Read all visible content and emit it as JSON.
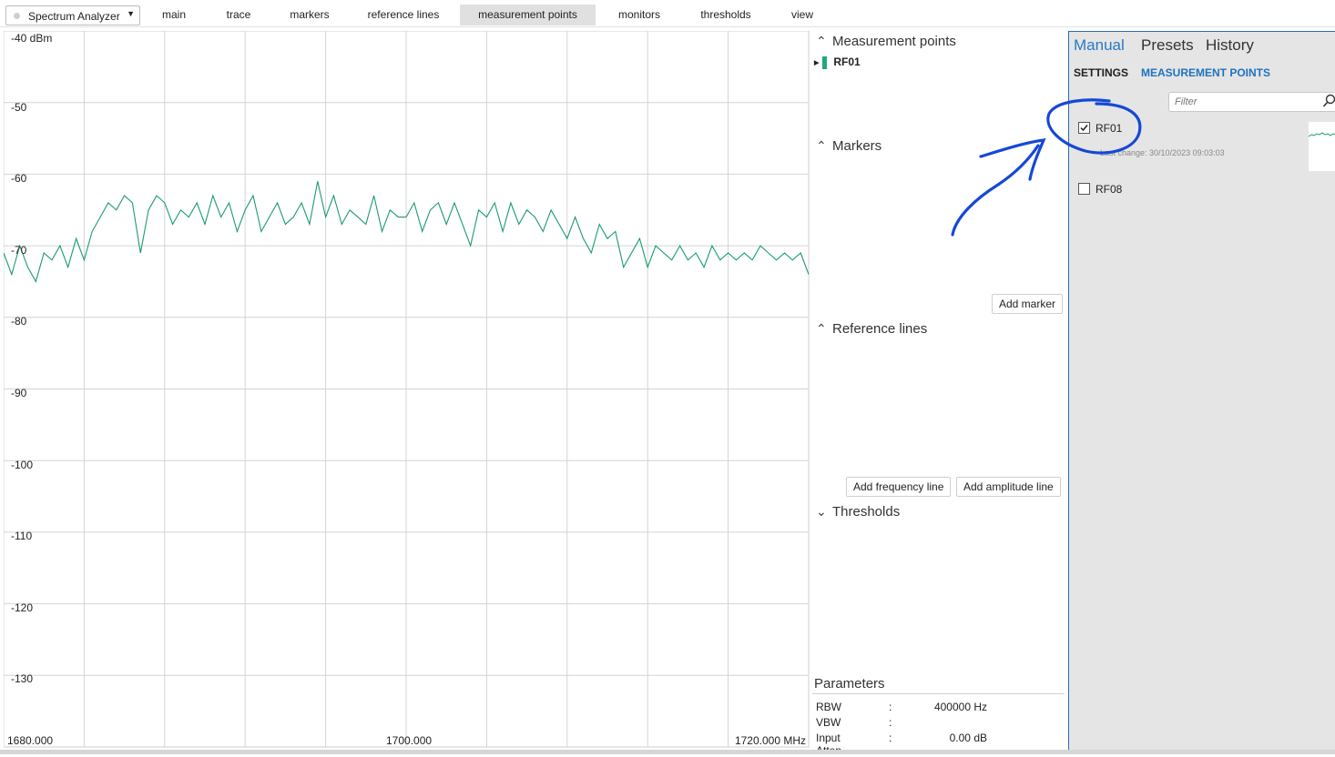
{
  "toolbar": {
    "app_selector": "Spectrum Analyzer",
    "tabs": [
      {
        "label": "main",
        "active": false
      },
      {
        "label": "trace",
        "active": false
      },
      {
        "label": "markers",
        "active": false
      },
      {
        "label": "reference lines",
        "active": false
      },
      {
        "label": "measurement points",
        "active": true
      },
      {
        "label": "monitors",
        "active": false
      },
      {
        "label": "thresholds",
        "active": false
      },
      {
        "label": "view",
        "active": false
      }
    ]
  },
  "chart_data": {
    "type": "line",
    "y_ticks": [
      "-40 dBm",
      "-50",
      "-60",
      "-70",
      "-80",
      "-90",
      "-100",
      "-110",
      "-120",
      "-130"
    ],
    "ylim": [
      -140,
      -40
    ],
    "x_tick_labels": [
      "1680.000",
      "1700.000",
      "1720.000 MHz"
    ],
    "xlim": [
      1680,
      1720
    ],
    "grid": true,
    "series": [
      {
        "color": "#1a9a74",
        "x": [
          1680.0,
          1680.4,
          1680.8,
          1681.2,
          1681.6,
          1682.0,
          1682.4,
          1682.8,
          1683.2,
          1683.6,
          1684.0,
          1684.4,
          1684.8,
          1685.2,
          1685.6,
          1686.0,
          1686.4,
          1686.8,
          1687.2,
          1687.6,
          1688.0,
          1688.4,
          1688.8,
          1689.2,
          1689.6,
          1690.0,
          1690.4,
          1690.8,
          1691.2,
          1691.6,
          1692.0,
          1692.4,
          1692.8,
          1693.2,
          1693.6,
          1694.0,
          1694.4,
          1694.8,
          1695.2,
          1695.6,
          1696.0,
          1696.4,
          1696.8,
          1697.2,
          1697.6,
          1698.0,
          1698.4,
          1698.8,
          1699.2,
          1699.6,
          1700.0,
          1700.4,
          1700.8,
          1701.2,
          1701.6,
          1702.0,
          1702.4,
          1702.8,
          1703.2,
          1703.6,
          1704.0,
          1704.4,
          1704.8,
          1705.2,
          1705.6,
          1706.0,
          1706.4,
          1706.8,
          1707.2,
          1707.6,
          1708.0,
          1708.4,
          1708.8,
          1709.2,
          1709.6,
          1710.0,
          1710.4,
          1710.8,
          1711.2,
          1711.6,
          1712.0,
          1712.4,
          1712.8,
          1713.2,
          1713.6,
          1714.0,
          1714.4,
          1714.8,
          1715.2,
          1715.6,
          1716.0,
          1716.4,
          1716.8,
          1717.2,
          1717.6,
          1718.0,
          1718.4,
          1718.8,
          1719.2,
          1719.6,
          1720.0
        ],
        "y": [
          -71,
          -74,
          -70,
          -73,
          -75,
          -71,
          -72,
          -70,
          -73,
          -69,
          -72,
          -68,
          -66,
          -64,
          -65,
          -63,
          -64,
          -71,
          -65,
          -63,
          -64,
          -67,
          -65,
          -66,
          -64,
          -67,
          -63,
          -66,
          -64,
          -68,
          -65,
          -63,
          -68,
          -66,
          -64,
          -67,
          -66,
          -64,
          -67,
          -61,
          -66,
          -63,
          -67,
          -65,
          -66,
          -67,
          -63,
          -68,
          -65,
          -66,
          -66,
          -64,
          -68,
          -65,
          -64,
          -67,
          -64,
          -67,
          -70,
          -65,
          -66,
          -64,
          -68,
          -64,
          -67,
          -65,
          -66,
          -68,
          -65,
          -67,
          -69,
          -66,
          -69,
          -71,
          -67,
          -69,
          -68,
          -73,
          -71,
          -69,
          -73,
          -70,
          -71,
          -72,
          -70,
          -72,
          -71,
          -73,
          -70,
          -72,
          -71,
          -72,
          -71,
          -72,
          -70,
          -71,
          -72,
          -71,
          -72,
          -71,
          -74
        ]
      }
    ]
  },
  "side": {
    "measurement_points": {
      "title": "Measurement points",
      "items": [
        "RF01"
      ]
    },
    "markers": {
      "title": "Markers",
      "add_label": "Add marker"
    },
    "reference_lines": {
      "title": "Reference lines",
      "add_freq_label": "Add frequency line",
      "add_amp_label": "Add amplitude line"
    },
    "thresholds": {
      "title": "Thresholds"
    },
    "parameters": {
      "title": "Parameters",
      "rows": [
        {
          "key": "RBW",
          "sep": ":",
          "value": "400000 Hz"
        },
        {
          "key": "VBW",
          "sep": ":",
          "value": ""
        },
        {
          "key": "Input Atten.",
          "sep": ":",
          "value": "0.00 dB"
        }
      ]
    }
  },
  "right": {
    "tabs": [
      {
        "label": "Manual",
        "active": true
      },
      {
        "label": "Presets",
        "active": false
      },
      {
        "label": "History",
        "active": false
      }
    ],
    "subtabs": [
      {
        "label": "SETTINGS",
        "color": "#111111"
      },
      {
        "label": "MEASUREMENT POINTS",
        "color": "#1e73be"
      }
    ],
    "filter_placeholder": "Filter",
    "points": [
      {
        "name": "RF01",
        "checked": true,
        "last_change": "Last change: 30/10/2023 09:03:03"
      },
      {
        "name": "RF08",
        "checked": false,
        "last_change": ""
      }
    ]
  },
  "colors": {
    "accent": "#2a7ac0",
    "trace": "#1a9a74",
    "annotation": "#1548d8"
  }
}
